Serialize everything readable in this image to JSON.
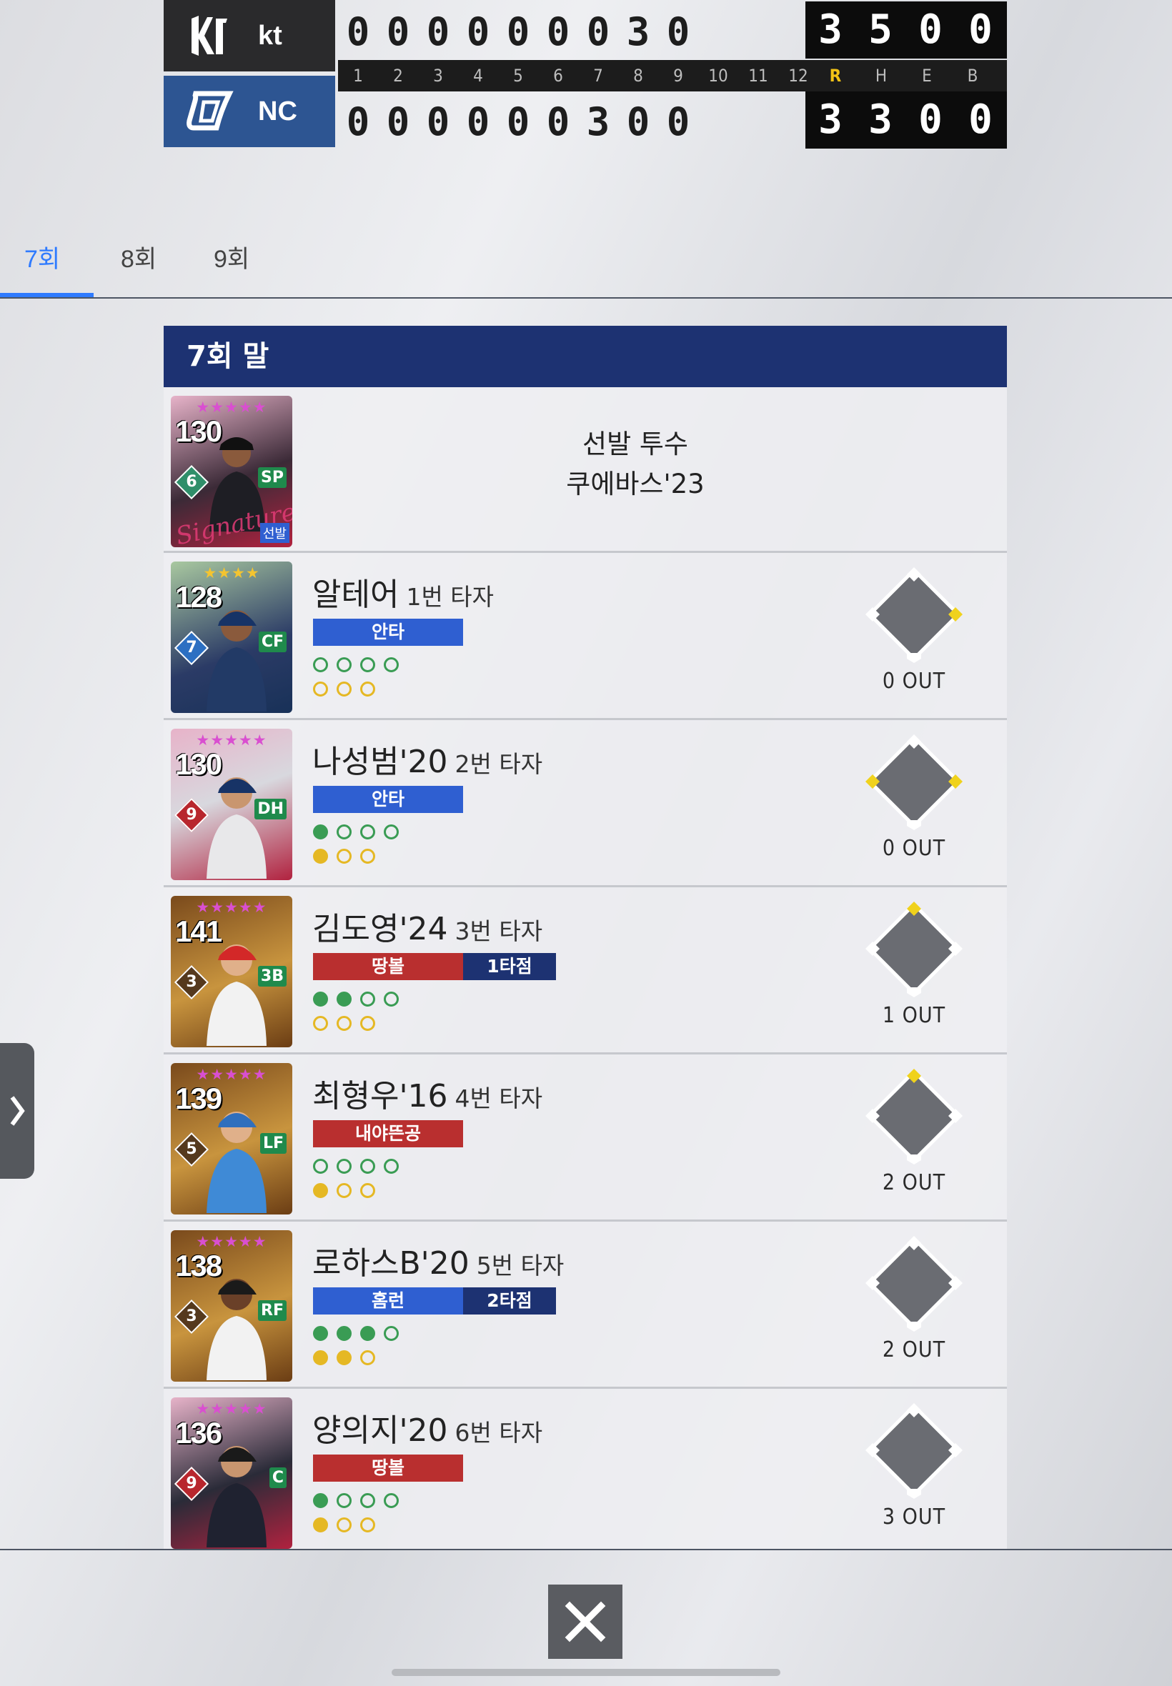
{
  "scoreboard": {
    "teams": [
      {
        "name": "kt",
        "innings": [
          "0",
          "0",
          "0",
          "0",
          "0",
          "0",
          "0",
          "3",
          "0"
        ],
        "totals": [
          "3",
          "5",
          "0",
          "0"
        ]
      },
      {
        "name": "NC",
        "innings": [
          "0",
          "0",
          "0",
          "0",
          "0",
          "0",
          "3",
          "0",
          "0"
        ],
        "totals": [
          "3",
          "3",
          "0",
          "0"
        ]
      }
    ],
    "headers": [
      "1",
      "2",
      "3",
      "4",
      "5",
      "6",
      "7",
      "8",
      "9",
      "10",
      "11",
      "12",
      "R",
      "H",
      "E",
      "B"
    ]
  },
  "tabs": [
    "7회",
    "8회",
    "9회"
  ],
  "active_tab": "7회",
  "half_title": "7회 말",
  "pitcher": {
    "role": "선발 투수",
    "name": "쿠에바스'23",
    "ovr": "130",
    "position": "SP",
    "level": "6",
    "tag": "선발"
  },
  "batters": [
    {
      "name": "알테어",
      "order": "1번 타자",
      "ovr": "128",
      "position": "CF",
      "level": "7",
      "stars": "★★★★",
      "results": [
        {
          "label": "안타",
          "color": "blue"
        }
      ],
      "balls": [
        false,
        false,
        false,
        false
      ],
      "strikes": [
        false,
        false,
        false
      ],
      "bases": [
        true,
        false,
        false
      ],
      "outs": "0 OUT"
    },
    {
      "name": "나성범'20",
      "order": "2번 타자",
      "ovr": "130",
      "position": "DH",
      "level": "9",
      "stars": "★★★★★",
      "results": [
        {
          "label": "안타",
          "color": "blue"
        }
      ],
      "balls": [
        true,
        false,
        false,
        false
      ],
      "strikes": [
        true,
        false,
        false
      ],
      "bases": [
        true,
        false,
        true
      ],
      "outs": "0 OUT"
    },
    {
      "name": "김도영'24",
      "order": "3번 타자",
      "ovr": "141",
      "position": "3B",
      "level": "3",
      "stars": "★★★★★",
      "results": [
        {
          "label": "땅볼",
          "color": "red"
        },
        {
          "label": "1타점",
          "color": "rbi"
        }
      ],
      "balls": [
        true,
        true,
        false,
        false
      ],
      "strikes": [
        false,
        false,
        false
      ],
      "bases": [
        false,
        true,
        false
      ],
      "outs": "1 OUT"
    },
    {
      "name": "최형우'16",
      "order": "4번 타자",
      "ovr": "139",
      "position": "LF",
      "level": "5",
      "stars": "★★★★★",
      "results": [
        {
          "label": "내야뜬공",
          "color": "red"
        }
      ],
      "balls": [
        false,
        false,
        false,
        false
      ],
      "strikes": [
        true,
        false,
        false
      ],
      "bases": [
        false,
        true,
        false
      ],
      "outs": "2 OUT"
    },
    {
      "name": "로하스B'20",
      "order": "5번 타자",
      "ovr": "138",
      "position": "RF",
      "level": "3",
      "stars": "★★★★★",
      "results": [
        {
          "label": "홈런",
          "color": "blue"
        },
        {
          "label": "2타점",
          "color": "rbi"
        }
      ],
      "balls": [
        true,
        true,
        true,
        false
      ],
      "strikes": [
        true,
        true,
        false
      ],
      "bases": [
        false,
        false,
        false
      ],
      "outs": "2 OUT"
    },
    {
      "name": "양의지'20",
      "order": "6번 타자",
      "ovr": "136",
      "position": "C",
      "level": "9",
      "stars": "★★★★★",
      "results": [
        {
          "label": "땅볼",
          "color": "red"
        }
      ],
      "balls": [
        true,
        false,
        false,
        false
      ],
      "strikes": [
        true,
        false,
        false
      ],
      "bases": [
        false,
        false,
        false
      ],
      "outs": "3 OUT"
    }
  ],
  "icons": {
    "close": "close-icon",
    "expand": "chevron-right-icon"
  },
  "colors": {
    "accent": "#2f7bff",
    "header": "#1d3272",
    "hit": "#2f5fd1",
    "out": "#b92f2f",
    "runner": "#f0d21c"
  }
}
